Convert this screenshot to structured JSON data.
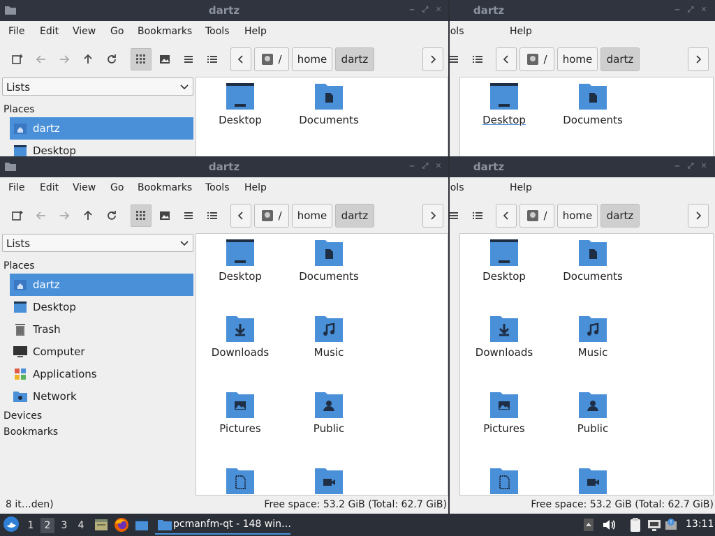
{
  "window_title": "dartz",
  "menu": [
    "File",
    "Edit",
    "View",
    "Go",
    "Bookmarks",
    "Tools",
    "Help"
  ],
  "path": {
    "root": "/",
    "home": "home",
    "user": "dartz"
  },
  "sidebar": {
    "mode": "Lists",
    "places_heading": "Places",
    "places": [
      "dartz",
      "Desktop",
      "Trash",
      "Computer",
      "Applications",
      "Network"
    ],
    "devices_heading": "Devices",
    "bookmarks_heading": "Bookmarks"
  },
  "files": [
    "Desktop",
    "Documents",
    "Downloads",
    "Music",
    "Pictures",
    "Public"
  ],
  "status": {
    "left": "8 it…den)",
    "right": "Free space: 53.2 GiB (Total: 62.7 GiB)"
  },
  "taskbar": {
    "workspaces": [
      "1",
      "2",
      "3",
      "4"
    ],
    "current_workspace": "2",
    "task_label": "pcmanfm-qt - 148 win…",
    "clock": "13:11"
  },
  "colors": {
    "folder": "#4a90d9",
    "accent": "#4a90d9",
    "titlebar": "#2f343f"
  }
}
